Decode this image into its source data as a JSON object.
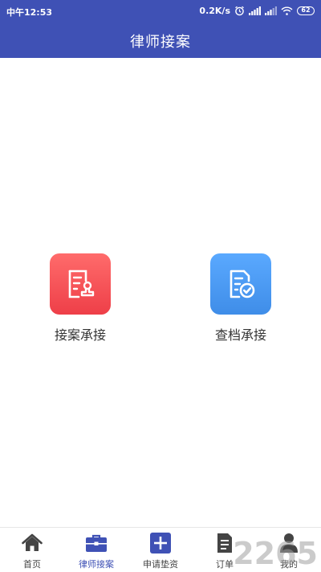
{
  "status_bar": {
    "time": "中午12:53",
    "net_speed": "0.2K/s",
    "battery": "62"
  },
  "header": {
    "title": "律师接案"
  },
  "features": [
    {
      "label": "接案承接",
      "icon": "case-doc-icon",
      "color": "#f0474f"
    },
    {
      "label": "查档承接",
      "icon": "doc-check-icon",
      "color": "#4a9af5"
    }
  ],
  "bottom_nav": {
    "items": [
      {
        "label": "首页",
        "icon": "home-icon"
      },
      {
        "label": "律师接案",
        "icon": "briefcase-icon",
        "active": true
      },
      {
        "label": "申请垫资",
        "icon": "plus-square-icon"
      },
      {
        "label": "订单",
        "icon": "document-icon"
      },
      {
        "label": "我的",
        "icon": "user-icon"
      }
    ]
  },
  "colors": {
    "primary": "#3f51b5",
    "text": "#333333"
  },
  "watermark": "2265"
}
